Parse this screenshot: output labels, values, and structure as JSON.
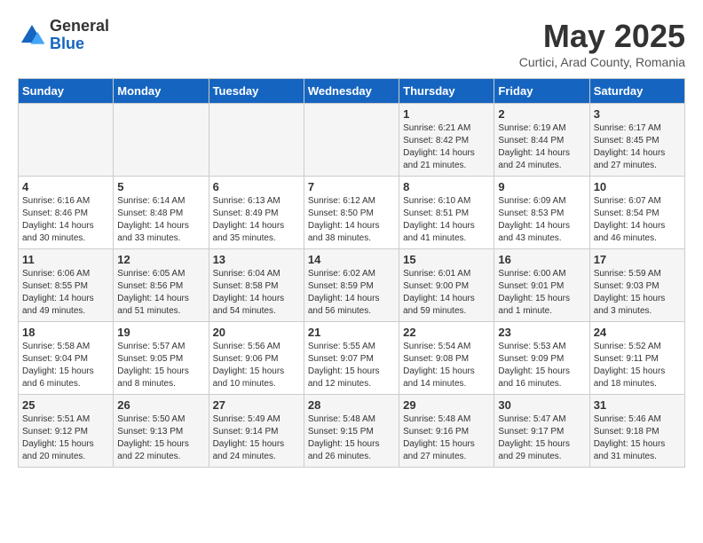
{
  "logo": {
    "general": "General",
    "blue": "Blue"
  },
  "title": "May 2025",
  "location": "Curtici, Arad County, Romania",
  "weekdays": [
    "Sunday",
    "Monday",
    "Tuesday",
    "Wednesday",
    "Thursday",
    "Friday",
    "Saturday"
  ],
  "weeks": [
    [
      {
        "day": "",
        "info": ""
      },
      {
        "day": "",
        "info": ""
      },
      {
        "day": "",
        "info": ""
      },
      {
        "day": "",
        "info": ""
      },
      {
        "day": "1",
        "info": "Sunrise: 6:21 AM\nSunset: 8:42 PM\nDaylight: 14 hours\nand 21 minutes."
      },
      {
        "day": "2",
        "info": "Sunrise: 6:19 AM\nSunset: 8:44 PM\nDaylight: 14 hours\nand 24 minutes."
      },
      {
        "day": "3",
        "info": "Sunrise: 6:17 AM\nSunset: 8:45 PM\nDaylight: 14 hours\nand 27 minutes."
      }
    ],
    [
      {
        "day": "4",
        "info": "Sunrise: 6:16 AM\nSunset: 8:46 PM\nDaylight: 14 hours\nand 30 minutes."
      },
      {
        "day": "5",
        "info": "Sunrise: 6:14 AM\nSunset: 8:48 PM\nDaylight: 14 hours\nand 33 minutes."
      },
      {
        "day": "6",
        "info": "Sunrise: 6:13 AM\nSunset: 8:49 PM\nDaylight: 14 hours\nand 35 minutes."
      },
      {
        "day": "7",
        "info": "Sunrise: 6:12 AM\nSunset: 8:50 PM\nDaylight: 14 hours\nand 38 minutes."
      },
      {
        "day": "8",
        "info": "Sunrise: 6:10 AM\nSunset: 8:51 PM\nDaylight: 14 hours\nand 41 minutes."
      },
      {
        "day": "9",
        "info": "Sunrise: 6:09 AM\nSunset: 8:53 PM\nDaylight: 14 hours\nand 43 minutes."
      },
      {
        "day": "10",
        "info": "Sunrise: 6:07 AM\nSunset: 8:54 PM\nDaylight: 14 hours\nand 46 minutes."
      }
    ],
    [
      {
        "day": "11",
        "info": "Sunrise: 6:06 AM\nSunset: 8:55 PM\nDaylight: 14 hours\nand 49 minutes."
      },
      {
        "day": "12",
        "info": "Sunrise: 6:05 AM\nSunset: 8:56 PM\nDaylight: 14 hours\nand 51 minutes."
      },
      {
        "day": "13",
        "info": "Sunrise: 6:04 AM\nSunset: 8:58 PM\nDaylight: 14 hours\nand 54 minutes."
      },
      {
        "day": "14",
        "info": "Sunrise: 6:02 AM\nSunset: 8:59 PM\nDaylight: 14 hours\nand 56 minutes."
      },
      {
        "day": "15",
        "info": "Sunrise: 6:01 AM\nSunset: 9:00 PM\nDaylight: 14 hours\nand 59 minutes."
      },
      {
        "day": "16",
        "info": "Sunrise: 6:00 AM\nSunset: 9:01 PM\nDaylight: 15 hours\nand 1 minute."
      },
      {
        "day": "17",
        "info": "Sunrise: 5:59 AM\nSunset: 9:03 PM\nDaylight: 15 hours\nand 3 minutes."
      }
    ],
    [
      {
        "day": "18",
        "info": "Sunrise: 5:58 AM\nSunset: 9:04 PM\nDaylight: 15 hours\nand 6 minutes."
      },
      {
        "day": "19",
        "info": "Sunrise: 5:57 AM\nSunset: 9:05 PM\nDaylight: 15 hours\nand 8 minutes."
      },
      {
        "day": "20",
        "info": "Sunrise: 5:56 AM\nSunset: 9:06 PM\nDaylight: 15 hours\nand 10 minutes."
      },
      {
        "day": "21",
        "info": "Sunrise: 5:55 AM\nSunset: 9:07 PM\nDaylight: 15 hours\nand 12 minutes."
      },
      {
        "day": "22",
        "info": "Sunrise: 5:54 AM\nSunset: 9:08 PM\nDaylight: 15 hours\nand 14 minutes."
      },
      {
        "day": "23",
        "info": "Sunrise: 5:53 AM\nSunset: 9:09 PM\nDaylight: 15 hours\nand 16 minutes."
      },
      {
        "day": "24",
        "info": "Sunrise: 5:52 AM\nSunset: 9:11 PM\nDaylight: 15 hours\nand 18 minutes."
      }
    ],
    [
      {
        "day": "25",
        "info": "Sunrise: 5:51 AM\nSunset: 9:12 PM\nDaylight: 15 hours\nand 20 minutes."
      },
      {
        "day": "26",
        "info": "Sunrise: 5:50 AM\nSunset: 9:13 PM\nDaylight: 15 hours\nand 22 minutes."
      },
      {
        "day": "27",
        "info": "Sunrise: 5:49 AM\nSunset: 9:14 PM\nDaylight: 15 hours\nand 24 minutes."
      },
      {
        "day": "28",
        "info": "Sunrise: 5:48 AM\nSunset: 9:15 PM\nDaylight: 15 hours\nand 26 minutes."
      },
      {
        "day": "29",
        "info": "Sunrise: 5:48 AM\nSunset: 9:16 PM\nDaylight: 15 hours\nand 27 minutes."
      },
      {
        "day": "30",
        "info": "Sunrise: 5:47 AM\nSunset: 9:17 PM\nDaylight: 15 hours\nand 29 minutes."
      },
      {
        "day": "31",
        "info": "Sunrise: 5:46 AM\nSunset: 9:18 PM\nDaylight: 15 hours\nand 31 minutes."
      }
    ]
  ]
}
